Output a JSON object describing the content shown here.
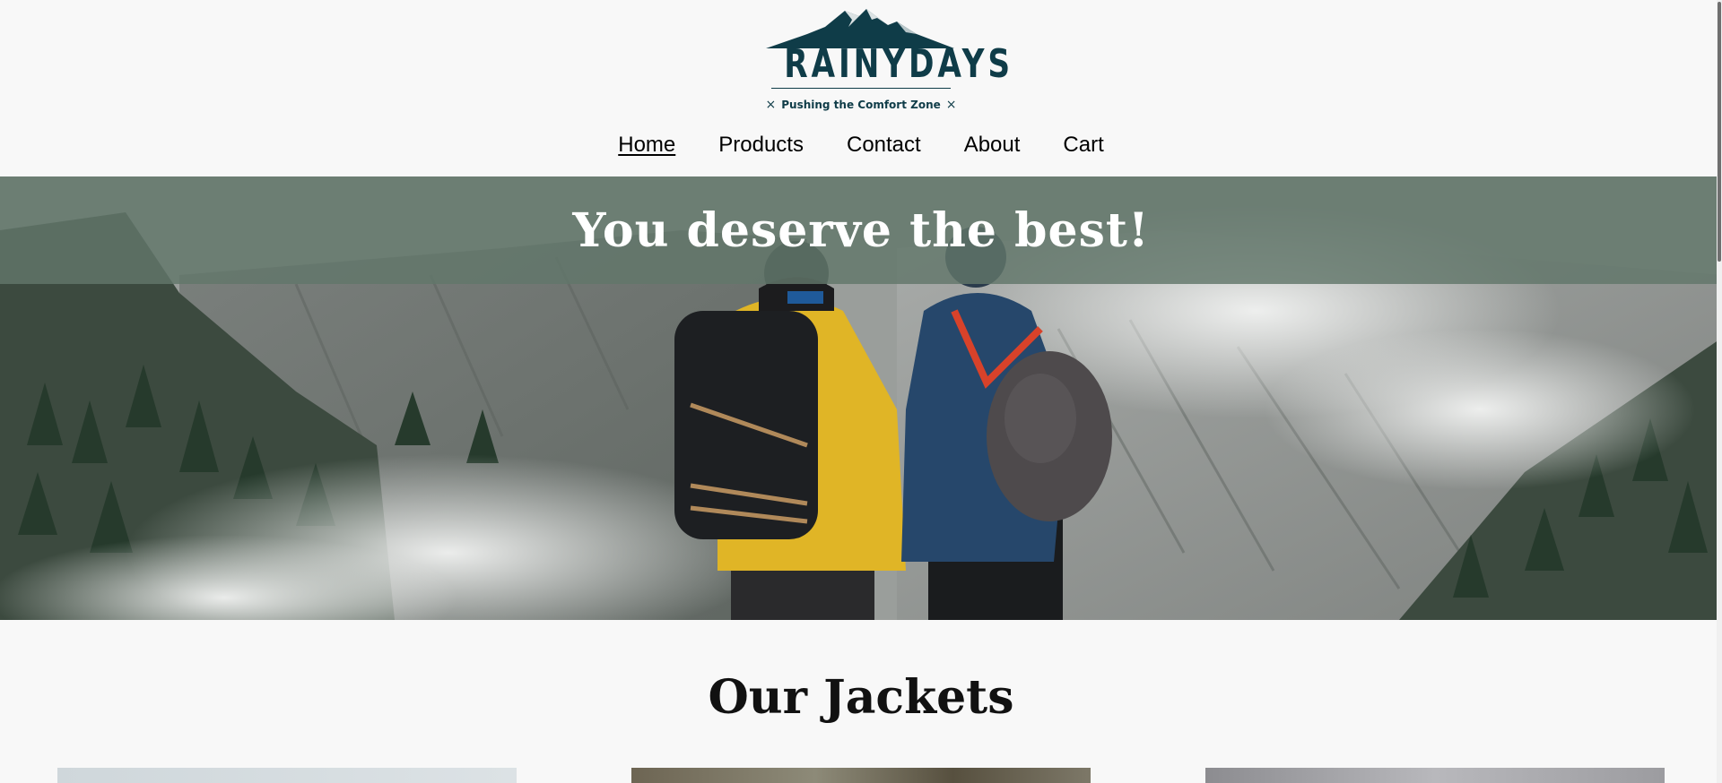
{
  "brand": {
    "name": "RAINYDAYS",
    "tagline": "Pushing the Comfort Zone",
    "tagline_marks": [
      "×",
      "×"
    ],
    "logo_icon": "mountain-icon",
    "color": "#0f3c48"
  },
  "nav": {
    "items": [
      {
        "label": "Home",
        "active": true
      },
      {
        "label": "Products",
        "active": false
      },
      {
        "label": "Contact",
        "active": false
      },
      {
        "label": "About",
        "active": false
      },
      {
        "label": "Cart",
        "active": false
      }
    ]
  },
  "hero": {
    "title": "You deserve the best!",
    "banner_color": "#62766a"
  },
  "jackets": {
    "title": "Our Jackets"
  }
}
